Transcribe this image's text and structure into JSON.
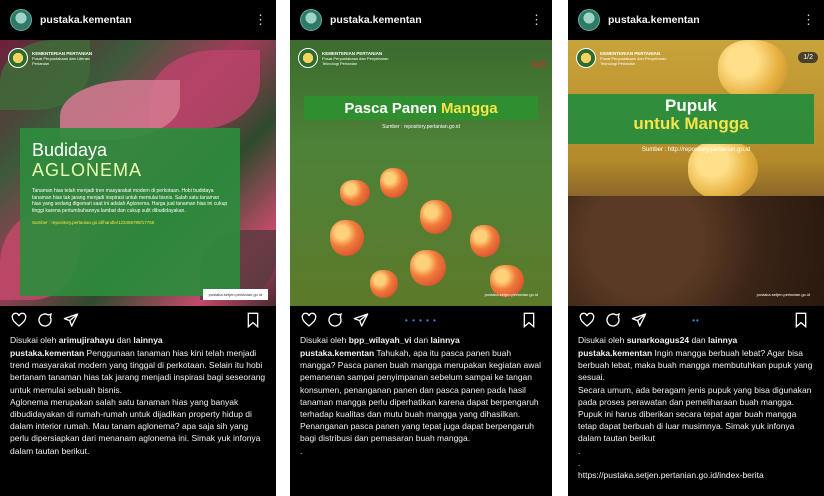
{
  "posts": [
    {
      "username": "pustaka.kementan",
      "image": {
        "ministry_title": "KEMENTERIAN PERTANIAN",
        "ministry_sub": "Pusat Perpustakaan dan Literasi Pertanian",
        "title": "Budidaya",
        "subtitle": "AGLONEMA",
        "body": "Tanaman hias telah menjadi tren masyarakat modern di perkotaan. Hobi budidaya tanaman hias tak jarang menjadi inspirasi untuk memulai bisnis. Salah satu tanaman hias yang sedang digemari saat ini adalah Aglonema. Harga jual tanaman hias ini cukup tinggi karena pertumbuhannya lambat dan cukup sulit dibudidayakan.",
        "source": "Sumber : repository.pertanian.go.id/handle/123456789/17755",
        "site_tag": "pustaka.setjen.pertanian.go.id"
      },
      "liked_by_prefix": "Disukai oleh",
      "liked_by_user": "arimujirahayu",
      "liked_by_suffix": "dan",
      "liked_by_others": "lainnya",
      "caption_user": "pustaka.kementan",
      "caption_p1": "Penggunaan tanaman hias kini telah menjadi trend masyarakat modern yang tinggal di perkotaan. Selain itu hobi bertanam tanaman hias tak jarang menjadi inspirasi bagi seseorang untuk memulai sebuah bisnis.",
      "caption_p2": "Aglonema merupakan salah satu tanaman hias yang banyak dibudidayakan di rumah-rumah untuk dijadikan property hidup di dalam interior rumah. Mau tanam aglonema? apa saja sih yang perlu dipersiapkan dari menanam aglonema ini. Simak yuk infonya dalam tautan berikut."
    },
    {
      "username": "pustaka.kementan",
      "image": {
        "ministry_title": "KEMENTERIAN PERTANIAN",
        "ministry_sub": "Pusat Perpustakaan dan Penyebaran Teknologi Pertanian",
        "g20": "G20",
        "title_a": "Pasca Panen",
        "title_b": "Mangga",
        "source": "Sumber : repository.pertanian.go.id",
        "site_tag": "pustaka.setjen.pertanian.go.id"
      },
      "pager": "• • • • •",
      "liked_by_prefix": "Disukai oleh",
      "liked_by_user": "bpp_wilayah_vi",
      "liked_by_suffix": "dan",
      "liked_by_others": "lainnya",
      "caption_user": "pustaka.kementan",
      "caption_p1": "Tahukah, apa itu pasca panen buah mangga? Pasca panen buah mangga merupakan kegiatan awal pemanenan sampai penyimpanan sebelum sampai ke tangan konsumen, penanganan panen dan pasca panen pada hasil tanaman mangga perlu diperhatikan karena dapat berpengaruh terhadap kualitas dan mutu buah mangga yang dihasilkan.",
      "caption_p2": "Penanganan pasca panen yang tepat juga dapat berpengaruh bagi distribusi dan pemasaran buah mangga.",
      "caption_p3": "."
    },
    {
      "username": "pustaka.kementan",
      "image": {
        "ministry_title": "KEMENTERIAN PERTANIAN",
        "ministry_sub": "Pusat Perpustakaan dan Penyebaran Teknologi Pertanian",
        "badge": "1/2",
        "title_a": "Pupuk",
        "title_b": "untuk Mangga",
        "source": "Sumber : http://repository.pertanian.go.id",
        "site_tag": "pustaka.setjen.pertanian.go.id"
      },
      "pager": "••",
      "liked_by_prefix": "Disukai oleh",
      "liked_by_user": "sunarkoagus24",
      "liked_by_suffix": "dan",
      "liked_by_others": "lainnya",
      "caption_user": "pustaka.kementan",
      "caption_p1": "Ingin mangga berbuah lebat? Agar bisa berbuah lebat, maka buah mangga membutuhkan pupuk yang sesuai.",
      "caption_p2": "Secara umum, ada beragam jenis pupuk yang bisa digunakan pada proses perawatan dan pemeliharaan buah mangga. Pupuk ini harus diberikan secara tepat agar buah mangga tetap dapat berbuah di luar musimnya. Simak yuk infonya dalam tautan berikut",
      "caption_p3": ".",
      "caption_p4": ".",
      "caption_link": "https://pustaka.setjen.pertanian.go.id/index-berita"
    }
  ]
}
